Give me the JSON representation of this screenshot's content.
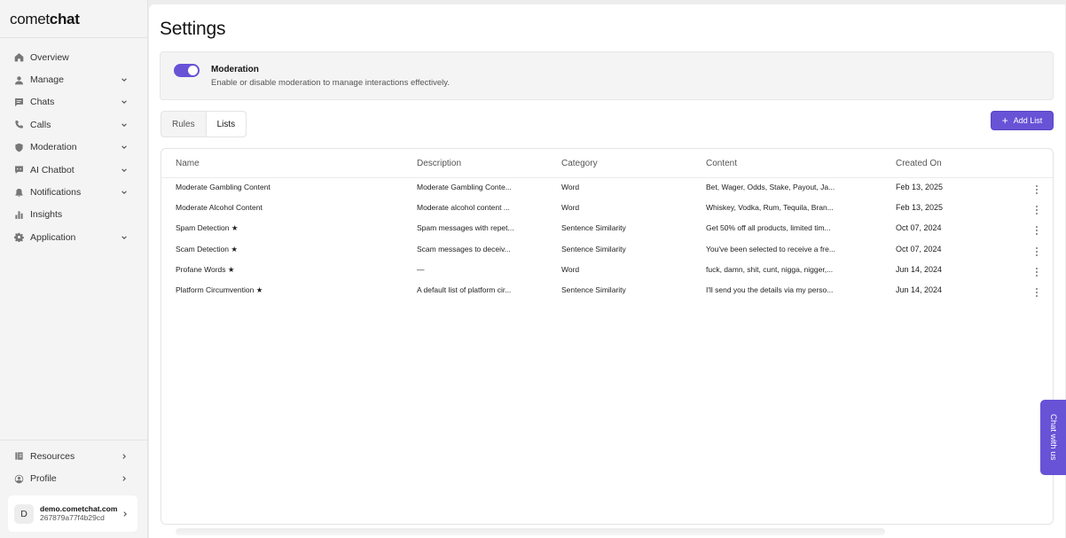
{
  "brand": {
    "logo_light": "comet",
    "logo_bold": "chat"
  },
  "sidebar": {
    "items": [
      {
        "label": "Overview",
        "icon": "home-icon",
        "has_chevron": false
      },
      {
        "label": "Manage",
        "icon": "user-icon",
        "has_chevron": true
      },
      {
        "label": "Chats",
        "icon": "chat-icon",
        "has_chevron": true
      },
      {
        "label": "Calls",
        "icon": "phone-icon",
        "has_chevron": true
      },
      {
        "label": "Moderation",
        "icon": "shield-icon",
        "has_chevron": true
      },
      {
        "label": "AI Chatbot",
        "icon": "bot-icon",
        "has_chevron": true
      },
      {
        "label": "Notifications",
        "icon": "bell-icon",
        "has_chevron": true
      },
      {
        "label": "Insights",
        "icon": "bar-chart-icon",
        "has_chevron": false
      },
      {
        "label": "Application",
        "icon": "gear-icon",
        "has_chevron": true
      }
    ],
    "bottom_items": [
      {
        "label": "Resources",
        "icon": "book-icon"
      },
      {
        "label": "Profile",
        "icon": "profile-icon"
      }
    ],
    "account": {
      "initial": "D",
      "domain": "demo.cometchat.com",
      "id": "267879a77f4b29cd"
    }
  },
  "page": {
    "title": "Settings"
  },
  "moderation": {
    "enabled": true,
    "title": "Moderation",
    "description": "Enable or disable moderation to manage interactions effectively."
  },
  "tabs": [
    {
      "label": "Rules",
      "active": false
    },
    {
      "label": "Lists",
      "active": true
    }
  ],
  "add_list_button": "Add List",
  "table": {
    "columns": [
      "Name",
      "Description",
      "Category",
      "Content",
      "Created On"
    ],
    "rows": [
      {
        "name": "Moderate Gambling Content",
        "description": "Moderate Gambling Conte...",
        "category": "Word",
        "content": "Bet, Wager, Odds, Stake, Payout, Ja...",
        "created": "Feb 13, 2025"
      },
      {
        "name": "Moderate Alcohol Content",
        "description": "Moderate alcohol content ...",
        "category": "Word",
        "content": "Whiskey, Vodka, Rum, Tequila, Bran...",
        "created": "Feb 13, 2025"
      },
      {
        "name": "Spam Detection ★",
        "description": "Spam messages with repet...",
        "category": "Sentence Similarity",
        "content": "Get 50% off all products, limited tim...",
        "created": "Oct 07, 2024"
      },
      {
        "name": "Scam Detection ★",
        "description": "Scam messages to deceiv...",
        "category": "Sentence Similarity",
        "content": "You've been selected to receive a fre...",
        "created": "Oct 07, 2024"
      },
      {
        "name": "Profane Words ★",
        "description": "—",
        "category": "Word",
        "content": "fuck, damn, shit, cunt, nigga, nigger,...",
        "created": "Jun 14, 2024"
      },
      {
        "name": "Platform Circumvention ★",
        "description": "A default list of platform cir...",
        "category": "Sentence Similarity",
        "content": "I'll send you the details via my perso...",
        "created": "Jun 14, 2024"
      }
    ]
  },
  "chat_widget": {
    "label": "Chat with us"
  },
  "colors": {
    "accent": "#6852d6",
    "sidebar_bg": "#f4f4f4",
    "page_bg": "#ffffff"
  }
}
